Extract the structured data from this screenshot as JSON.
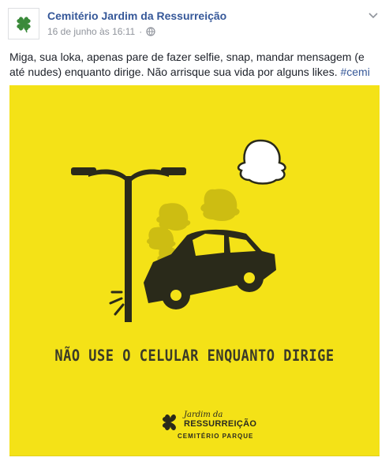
{
  "post": {
    "page_name": "Cemitério Jardim da Ressurreição",
    "date": "16 de junho às 16:11",
    "separator": "·",
    "text": "Miga, sua loka, apenas pare de fazer selfie, snap, mandar mensagem (e até nudes) enquanto dirige. Não arrisque sua vida por alguns likes. ",
    "hashtag": "#cemi"
  },
  "image": {
    "headline_part1": "NÃO USE O CELULAR ",
    "headline_part2": "ENQUANTO DIRIGE",
    "logo_line1": "Jardim da",
    "logo_line2": "RESSURREIÇÃO",
    "logo_line3": "CEMITÉRIO PARQUE",
    "background_color": "#f4e217"
  },
  "icons": {
    "avatar": "clover-icon",
    "privacy": "globe-icon",
    "menu": "chevron-down-icon"
  }
}
